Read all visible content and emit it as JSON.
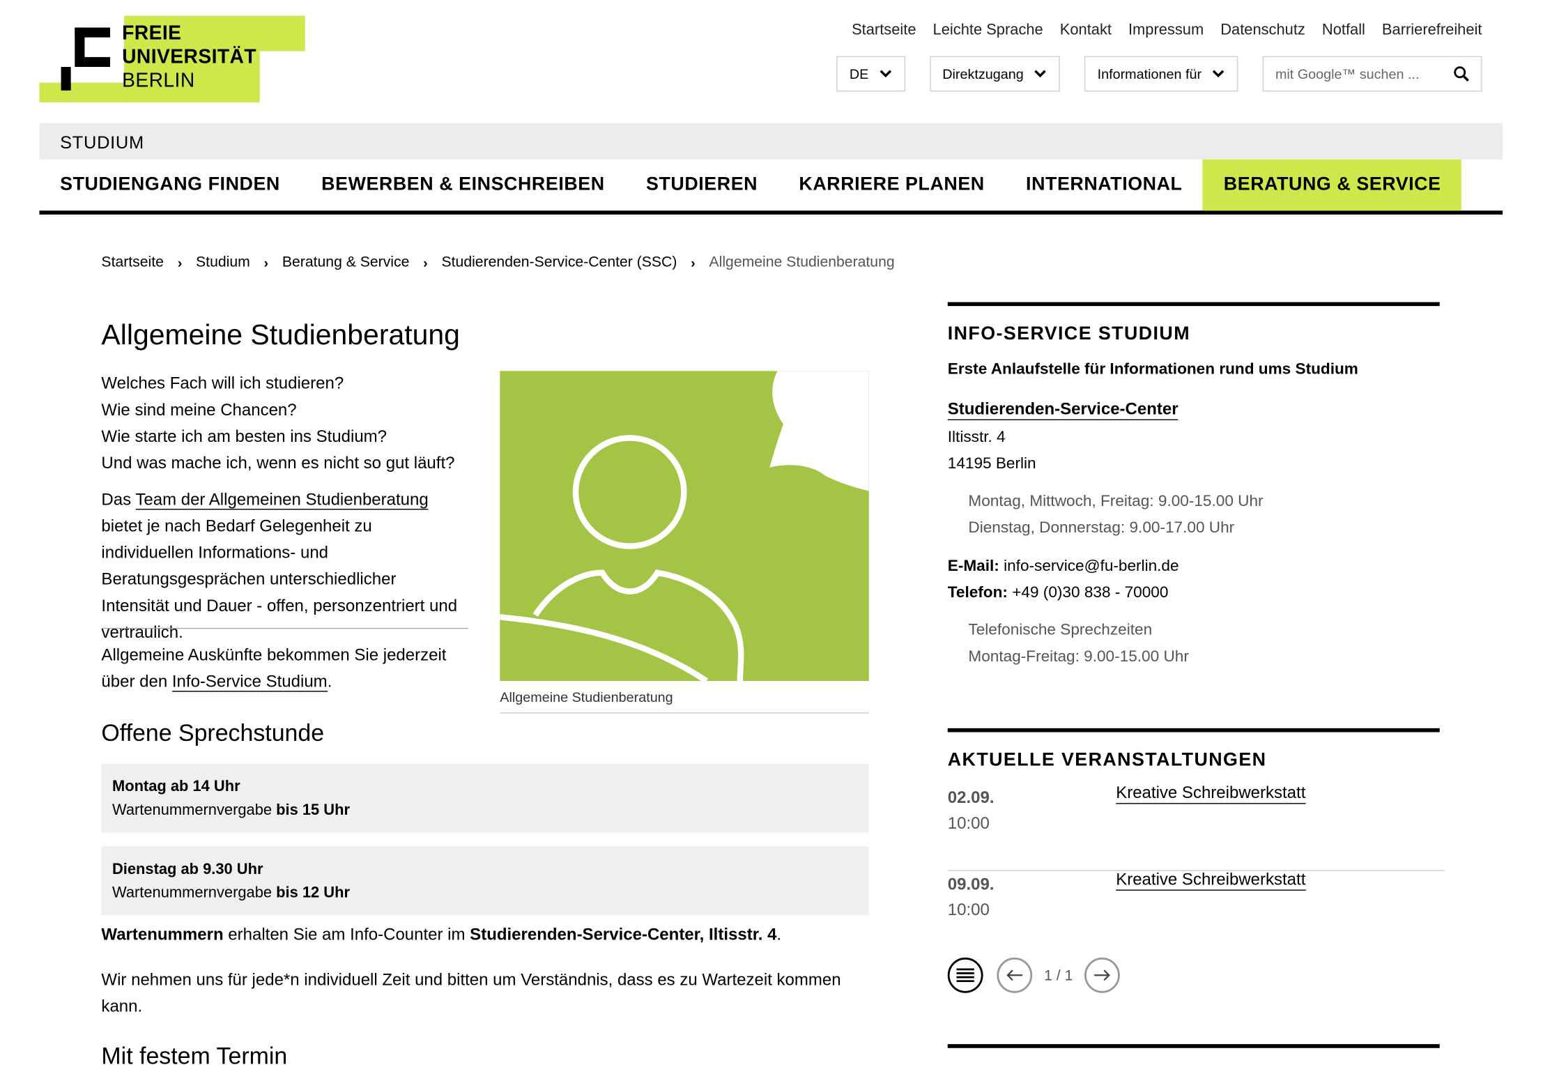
{
  "logo": {
    "line1": "FREIE",
    "line2": "UNIVERSITÄT",
    "line3": "BERLIN"
  },
  "toplinks": [
    "Startseite",
    "Leichte Sprache",
    "Kontakt",
    "Impressum",
    "Datenschutz",
    "Notfall",
    "Barrierefreiheit"
  ],
  "controls": {
    "lang": "DE",
    "direct": "Direktzugang",
    "info": "Informationen für",
    "search_placeholder": "mit Google™ suchen ..."
  },
  "section": "STUDIUM",
  "nav": [
    "STUDIENGANG FINDEN",
    "BEWERBEN & EINSCHREIBEN",
    "STUDIEREN",
    "KARRIERE PLANEN",
    "INTERNATIONAL",
    "BERATUNG & SERVICE"
  ],
  "breadcrumb": [
    "Startseite",
    "Studium",
    "Beratung & Service",
    "Studierenden-Service-Center (SSC)",
    "Allgemeine Studienberatung"
  ],
  "main": {
    "title": "Allgemeine Studienberatung",
    "questions": [
      "Welches Fach will ich studieren?",
      "Wie sind meine Chancen?",
      "Wie starte ich am besten ins Studium?",
      "Und was mache ich, wenn es nicht so gut läuft?"
    ],
    "para1_pre": "Das ",
    "para1_link": "Team der Allgemeinen Studienberatung",
    "para1_post": " bietet je nach Bedarf Gelegenheit zu individuellen Informations- und Beratungsgesprächen unterschiedlicher Intensität und Dauer - offen, personzentriert und vertraulich.",
    "para2_pre": "Allgemeine Auskünfte bekommen Sie jederzeit über den ",
    "para2_link": "Info-Service Studium",
    "para2_post": ".",
    "figure_caption": "Allgemeine Studienberatung",
    "h2_open": "Offene Sprechstunde",
    "slot1_title": "Montag ab 14 Uhr",
    "slot1_pre": "Wartenummernvergabe ",
    "slot1_bold": "bis 15 Uhr",
    "slot2_title": "Dienstag ab 9.30 Uhr",
    "slot2_pre": "Wartenummernvergabe ",
    "slot2_bold": "bis 12 Uhr",
    "info1_b1": "Wartenummern",
    "info1_mid": " erhalten Sie am Info-Counter im ",
    "info1_b2": "Studierenden-Service-Center, Iltisstr. 4",
    "info1_end": ".",
    "info2": "Wir nehmen uns für jede*n individuell Zeit und bitten um Verständnis, dass es zu Wartezeit kommen kann.",
    "h2_fixed": "Mit festem Termin"
  },
  "sidebar": {
    "title": "INFO-SERVICE STUDIUM",
    "lead": "Erste Anlaufstelle für Informationen rund ums Studium",
    "link": "Studierenden-Service-Center",
    "street": "Iltisstr. 4",
    "city": "14195 Berlin",
    "hours1": "Montag, Mittwoch, Freitag: 9.00-15.00 Uhr",
    "hours2": "Dienstag, Donnerstag: 9.00-17.00 Uhr",
    "email_label": "E-Mail:",
    "email": " info-service@fu-berlin.de",
    "phone_label": "Telefon:",
    "phone": " +49 (0)30 838 - 70000",
    "phone_hours_label": "Telefonische Sprechzeiten",
    "phone_hours": "Montag-Freitag: 9.00-15.00 Uhr"
  },
  "events": {
    "title": "AKTUELLE VERANSTALTUNGEN",
    "items": [
      {
        "date": "02.09.",
        "time": "10:00",
        "title": "Kreative Schreibwerkstatt"
      },
      {
        "date": "09.09.",
        "time": "10:00",
        "title": "Kreative Schreibwerkstatt"
      }
    ],
    "pager": "1 / 1"
  },
  "colors": {
    "accent": "#cce84a",
    "image_green": "#a3c444"
  }
}
